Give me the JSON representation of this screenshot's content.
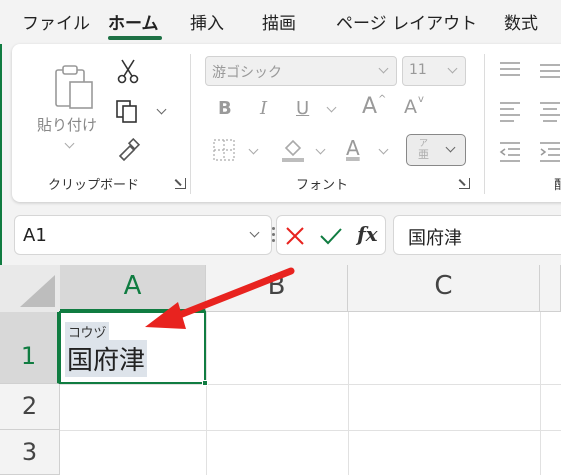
{
  "tabs": [
    {
      "label": "ファイル",
      "active": false
    },
    {
      "label": "ホーム",
      "active": true
    },
    {
      "label": "挿入",
      "active": false
    },
    {
      "label": "描画",
      "active": false
    },
    {
      "label": "ページ レイアウト",
      "active": false
    },
    {
      "label": "数式",
      "active": false
    }
  ],
  "ribbon": {
    "clipboard": {
      "paste_label": "貼り付け",
      "group_label": "クリップボード"
    },
    "font": {
      "font_name": "游ゴシック",
      "font_size": "11",
      "bold": "B",
      "italic": "I",
      "underline": "U",
      "grow": "A",
      "shrink": "A",
      "font_color_letter": "A",
      "group_label": "フォント"
    },
    "alignment": {
      "group_label_partial": "配"
    }
  },
  "formula_bar": {
    "name_box": "A1",
    "fx": "fx",
    "content": "国府津"
  },
  "grid": {
    "columns": [
      "A",
      "B",
      "C"
    ],
    "selected_column": "A",
    "rows": [
      "1",
      "2",
      "3"
    ],
    "selected_row": "1",
    "cells": {
      "A1": {
        "value": "国府津",
        "furigana": "コウヅ"
      }
    }
  },
  "colors": {
    "accent": "#107c41",
    "arrow": "#e8231f"
  }
}
